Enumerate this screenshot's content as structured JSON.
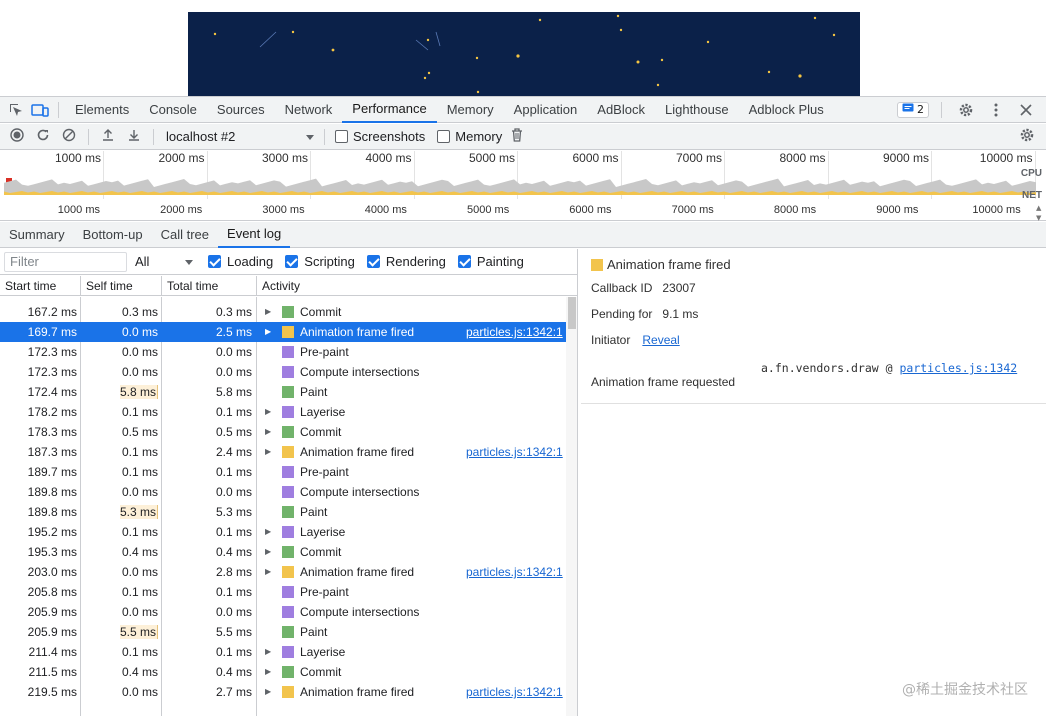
{
  "devtools_tabs": [
    "Elements",
    "Console",
    "Sources",
    "Network",
    "Performance",
    "Memory",
    "Application",
    "AdBlock",
    "Lighthouse",
    "Adblock Plus"
  ],
  "active_tab": "Performance",
  "issues_count": "2",
  "toolbar": {
    "target": "localhost #2",
    "screenshots_label": "Screenshots",
    "memory_label": "Memory",
    "screenshots_checked": false,
    "memory_checked": false
  },
  "overview": {
    "ticks": [
      "1000 ms",
      "2000 ms",
      "3000 ms",
      "4000 ms",
      "5000 ms",
      "6000 ms",
      "7000 ms",
      "8000 ms",
      "9000 ms",
      "10000 ms"
    ],
    "cpu_label": "CPU",
    "net_label": "NET"
  },
  "ruler_ticks": [
    "1000 ms",
    "2000 ms",
    "3000 ms",
    "4000 ms",
    "5000 ms",
    "6000 ms",
    "7000 ms",
    "8000 ms",
    "9000 ms",
    "10000 ms"
  ],
  "subtabs": [
    "Summary",
    "Bottom-up",
    "Call tree",
    "Event log"
  ],
  "active_subtab": "Event log",
  "filter": {
    "placeholder": "Filter",
    "level": "All",
    "checks": [
      "Loading",
      "Scripting",
      "Rendering",
      "Painting"
    ]
  },
  "columns": [
    "Start time",
    "Self time",
    "Total time",
    "Activity"
  ],
  "colors": {
    "rendering": "#9f7ee0",
    "painting": "#71b36b",
    "scripting": "#f2c44d",
    "selection": "#1a73e8"
  },
  "rows": [
    {
      "start": "167.2 ms",
      "self": "0.3 ms",
      "total": "0.3 ms",
      "activity": "Commit",
      "cat": "painting",
      "expand": true,
      "link": "",
      "heat": false
    },
    {
      "start": "169.7 ms",
      "self": "0.0 ms",
      "total": "2.5 ms",
      "activity": "Animation frame fired",
      "cat": "scripting",
      "expand": true,
      "link": "particles.js:1342:1",
      "heat": false,
      "selected": true
    },
    {
      "start": "172.3 ms",
      "self": "0.0 ms",
      "total": "0.0 ms",
      "activity": "Pre-paint",
      "cat": "rendering",
      "expand": false,
      "link": "",
      "heat": false
    },
    {
      "start": "172.3 ms",
      "self": "0.0 ms",
      "total": "0.0 ms",
      "activity": "Compute intersections",
      "cat": "rendering",
      "expand": false,
      "link": "",
      "heat": false
    },
    {
      "start": "172.4 ms",
      "self": "5.8 ms",
      "total": "5.8 ms",
      "activity": "Paint",
      "cat": "painting",
      "expand": false,
      "link": "",
      "heat": true
    },
    {
      "start": "178.2 ms",
      "self": "0.1 ms",
      "total": "0.1 ms",
      "activity": "Layerise",
      "cat": "rendering",
      "expand": true,
      "link": "",
      "heat": false
    },
    {
      "start": "178.3 ms",
      "self": "0.5 ms",
      "total": "0.5 ms",
      "activity": "Commit",
      "cat": "painting",
      "expand": true,
      "link": "",
      "heat": false
    },
    {
      "start": "187.3 ms",
      "self": "0.1 ms",
      "total": "2.4 ms",
      "activity": "Animation frame fired",
      "cat": "scripting",
      "expand": true,
      "link": "particles.js:1342:1",
      "heat": false
    },
    {
      "start": "189.7 ms",
      "self": "0.1 ms",
      "total": "0.1 ms",
      "activity": "Pre-paint",
      "cat": "rendering",
      "expand": false,
      "link": "",
      "heat": false
    },
    {
      "start": "189.8 ms",
      "self": "0.0 ms",
      "total": "0.0 ms",
      "activity": "Compute intersections",
      "cat": "rendering",
      "expand": false,
      "link": "",
      "heat": false
    },
    {
      "start": "189.8 ms",
      "self": "5.3 ms",
      "total": "5.3 ms",
      "activity": "Paint",
      "cat": "painting",
      "expand": false,
      "link": "",
      "heat": true
    },
    {
      "start": "195.2 ms",
      "self": "0.1 ms",
      "total": "0.1 ms",
      "activity": "Layerise",
      "cat": "rendering",
      "expand": true,
      "link": "",
      "heat": false
    },
    {
      "start": "195.3 ms",
      "self": "0.4 ms",
      "total": "0.4 ms",
      "activity": "Commit",
      "cat": "painting",
      "expand": true,
      "link": "",
      "heat": false
    },
    {
      "start": "203.0 ms",
      "self": "0.0 ms",
      "total": "2.8 ms",
      "activity": "Animation frame fired",
      "cat": "scripting",
      "expand": true,
      "link": "particles.js:1342:1",
      "heat": false
    },
    {
      "start": "205.8 ms",
      "self": "0.1 ms",
      "total": "0.1 ms",
      "activity": "Pre-paint",
      "cat": "rendering",
      "expand": false,
      "link": "",
      "heat": false
    },
    {
      "start": "205.9 ms",
      "self": "0.0 ms",
      "total": "0.0 ms",
      "activity": "Compute intersections",
      "cat": "rendering",
      "expand": false,
      "link": "",
      "heat": false
    },
    {
      "start": "205.9 ms",
      "self": "5.5 ms",
      "total": "5.5 ms",
      "activity": "Paint",
      "cat": "painting",
      "expand": false,
      "link": "",
      "heat": true
    },
    {
      "start": "211.4 ms",
      "self": "0.1 ms",
      "total": "0.1 ms",
      "activity": "Layerise",
      "cat": "rendering",
      "expand": true,
      "link": "",
      "heat": false
    },
    {
      "start": "211.5 ms",
      "self": "0.4 ms",
      "total": "0.4 ms",
      "activity": "Commit",
      "cat": "painting",
      "expand": true,
      "link": "",
      "heat": false
    },
    {
      "start": "219.5 ms",
      "self": "0.0 ms",
      "total": "2.7 ms",
      "activity": "Animation frame fired",
      "cat": "scripting",
      "expand": true,
      "link": "particles.js:1342:1",
      "heat": false
    }
  ],
  "details": {
    "title": "Animation frame fired",
    "callback_label": "Callback ID",
    "callback_value": "23007",
    "pending_label": "Pending for",
    "pending_value": "9.1 ms",
    "initiator_label": "Initiator",
    "initiator_link": "Reveal",
    "requested_label": "Animation frame requested",
    "stack_fn": "a.fn.vendors.draw @ ",
    "stack_link": "particles.js:1342"
  },
  "watermark": "@稀土掘金技术社区"
}
